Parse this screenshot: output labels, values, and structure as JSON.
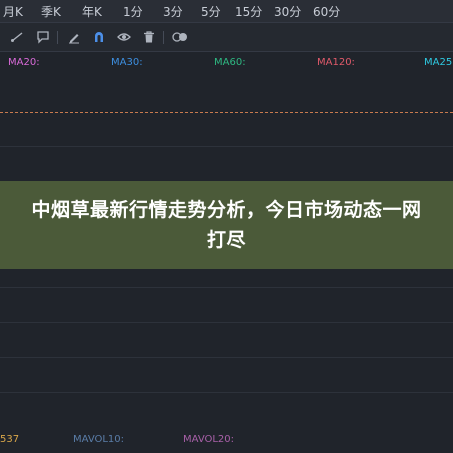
{
  "period_tabs": [
    "月K",
    "季K",
    "年K",
    "1分",
    "3分",
    "5分",
    "15分",
    "30分",
    "60分"
  ],
  "toolbar": {
    "icons": [
      "line-tool-icon",
      "comment-icon",
      "pen-icon",
      "magnet-icon",
      "eye-icon",
      "trash-icon",
      "toggle-icon"
    ]
  },
  "ma_legend": [
    {
      "label": "MA20:",
      "color": "#d86ad8"
    },
    {
      "label": "MA30:",
      "color": "#3d8fe0"
    },
    {
      "label": "MA60:",
      "color": "#2eb882"
    },
    {
      "label": "MA120:",
      "color": "#e05a6a"
    },
    {
      "label": "MA25",
      "color": "#2ec8e0"
    }
  ],
  "banner": {
    "title": "中烟草最新行情走势分析，今日市场动态一网打尽"
  },
  "volume_legend": [
    {
      "label": "537",
      "color": "#d8a64a"
    },
    {
      "label": "MAVOL10:",
      "color": "#5a7da8"
    },
    {
      "label": "MAVOL20:",
      "color": "#a860a8"
    }
  ],
  "colors": {
    "background": "#20242b",
    "price_line": "#c87a4e",
    "banner": "#4c5c3a"
  }
}
